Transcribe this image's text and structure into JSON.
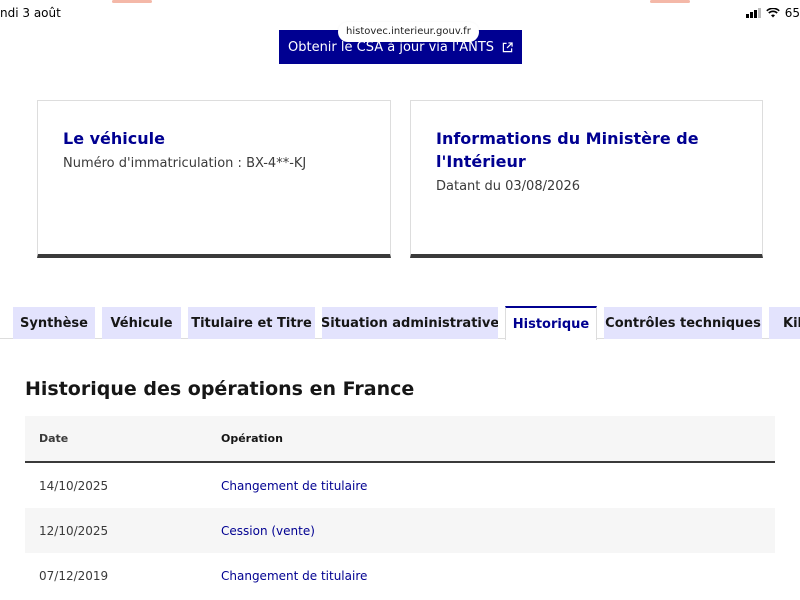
{
  "status": {
    "time": "ndi 3 août",
    "battery": "65"
  },
  "browser": {
    "url": "histovec.interieur.gouv.fr"
  },
  "csa_button": {
    "label": "Obtenir le CSA à jour via l'ANTS"
  },
  "cards": {
    "vehicle": {
      "title": "Le véhicule",
      "text": "Numéro d'immatriculation : BX-4**-KJ"
    },
    "ministry": {
      "title": "Informations du Ministère de l'Intérieur",
      "text": "Datant du 03/08/2026"
    }
  },
  "tabs": [
    {
      "label": "Synthèse",
      "active": false
    },
    {
      "label": "Véhicule",
      "active": false
    },
    {
      "label": "Titulaire et Titre",
      "active": false
    },
    {
      "label": "Situation administrative",
      "active": false
    },
    {
      "label": "Historique",
      "active": true
    },
    {
      "label": "Contrôles techniques",
      "active": false
    },
    {
      "label": "Kilo",
      "active": false
    }
  ],
  "history": {
    "title": "Historique des opérations en France",
    "columns": {
      "date": "Date",
      "operation": "Opération"
    },
    "rows": [
      {
        "date": "14/10/2025",
        "operation": "Changement de titulaire"
      },
      {
        "date": "12/10/2025",
        "operation": "Cession (vente)"
      },
      {
        "date": "07/12/2019",
        "operation": "Changement de titulaire"
      }
    ]
  },
  "colors": {
    "primary": "#000091",
    "tab_bg": "#e3e3fd",
    "row_alt": "#f6f6f6"
  }
}
